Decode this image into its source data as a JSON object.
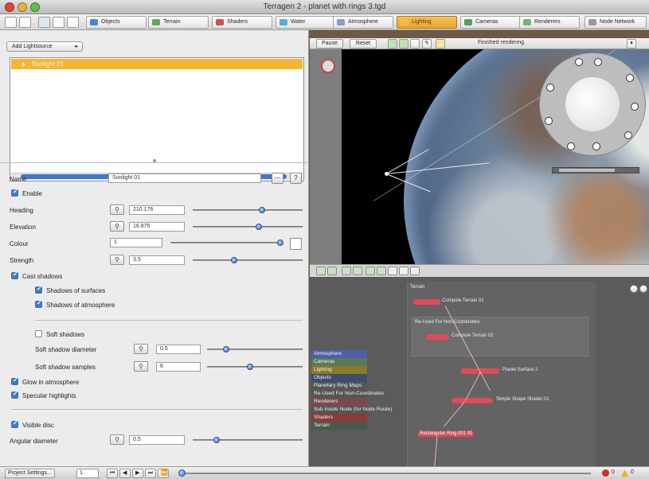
{
  "window": {
    "title": "Terragen 2 - planet with rings 3.tgd"
  },
  "tabs": [
    {
      "label": "Objects",
      "color": "#4a86d8"
    },
    {
      "label": "Terrain",
      "color": "#6aa35a"
    },
    {
      "label": "Shaders",
      "color": "#d05050"
    },
    {
      "label": "Water",
      "color": "#5aa8e0"
    },
    {
      "label": "Atmosphere",
      "color": "#8a9cc0"
    },
    {
      "label": "Lighting",
      "color": "#f0c040"
    },
    {
      "label": "Cameras",
      "color": "#5a9a5a"
    },
    {
      "label": "Renderers",
      "color": "#7ab07a"
    },
    {
      "label": "Node Network",
      "color": "#999999"
    }
  ],
  "left": {
    "add_button": "Add Lightsource",
    "list_items": [
      "Sunlight 01"
    ],
    "name_label": "Name",
    "name_value": "Sunlight 01",
    "enable": "Enable",
    "heading_label": "Heading",
    "heading_value": "210.176",
    "elevation_label": "Elevation",
    "elevation_value": "16.875",
    "colour_label": "Colour",
    "colour_value": "1",
    "strength_label": "Strength",
    "strength_value": "3.5",
    "cast_shadows": "Cast shadows",
    "shadows_surfaces": "Shadows of surfaces",
    "shadows_atmosphere": "Shadows of atmosphere",
    "soft_shadows": "Soft shadows",
    "soft_diameter_label": "Soft shadow diameter",
    "soft_diameter_value": "0.5",
    "soft_samples_label": "Soft shadow samples",
    "soft_samples_value": "8",
    "glow_atmosphere": "Glow in atmosphere",
    "specular": "Specular highlights",
    "visible_disc": "Visible disc",
    "angular_label": "Angular diameter",
    "angular_value": "0.5",
    "slider_levels": {
      "heading": 0.63,
      "elevation": 0.6,
      "colour": 0.97,
      "strength": 0.38,
      "soft_diameter": 0.2,
      "soft_samples": 0.45,
      "angular": 0.22
    }
  },
  "viewport": {
    "pause": "Pause",
    "reset": "Reset",
    "status": "Finished rendering"
  },
  "nodes": {
    "labels": [
      "Terrain",
      "Compute Terrain 01",
      "Re-Used For Non-Coordinates",
      "Compute Terrain 02",
      "Planet Surface 2",
      "Simple Shape Shader 01",
      "Rectangular Ring 001 01"
    ],
    "navlist": [
      {
        "label": "Atmosphere",
        "color": "#4e5fa8"
      },
      {
        "label": "Cameras",
        "color": "#5a7a5a"
      },
      {
        "label": "Lighting",
        "color": "#8a7a2a"
      },
      {
        "label": "Objects",
        "color": "#3d4d6d"
      },
      {
        "label": "Planetary Ring Maps",
        "color": "#555555"
      },
      {
        "label": "Re-Used For Non-Coordinates",
        "color": "#555555"
      },
      {
        "label": "Renderers",
        "color": "#7a4a4a"
      },
      {
        "label": "Sub Inside Node (for Node Route)",
        "color": "#555555"
      },
      {
        "label": "Shaders",
        "color": "#8a3a3a"
      },
      {
        "label": "Terrain",
        "color": "#4a5a4a"
      }
    ]
  },
  "bottom": {
    "project_settings": "Project Settings...",
    "frame": "1",
    "errors": "0",
    "warnings": "0"
  }
}
